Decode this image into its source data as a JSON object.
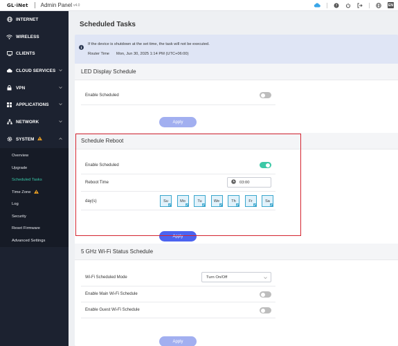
{
  "topbar": {
    "logo": "GL·iNet",
    "title": "Admin Panel",
    "version": "v4.0",
    "icons": [
      "cloud-icon",
      "help-icon",
      "power-icon",
      "logout-icon",
      "globe-icon",
      "language-icon"
    ],
    "language": "EN"
  },
  "sidebar": {
    "items": [
      {
        "label": "INTERNET",
        "icon": "globe-icon"
      },
      {
        "label": "WIRELESS",
        "icon": "wifi-icon"
      },
      {
        "label": "CLIENTS",
        "icon": "clients-icon"
      },
      {
        "label": "CLOUD SERVICES",
        "icon": "cloud-icon"
      },
      {
        "label": "VPN",
        "icon": "vpn-icon"
      },
      {
        "label": "APPLICATIONS",
        "icon": "applications-icon"
      },
      {
        "label": "NETWORK",
        "icon": "network-icon"
      },
      {
        "label": "SYSTEM",
        "icon": "gear-icon"
      }
    ],
    "system_sub": [
      {
        "label": "Overview"
      },
      {
        "label": "Upgrade"
      },
      {
        "label": "Scheduled Tasks",
        "active": true
      },
      {
        "label": "Time Zone",
        "warning": true
      },
      {
        "label": "Log"
      },
      {
        "label": "Security"
      },
      {
        "label": "Reset Firmware"
      },
      {
        "label": "Advanced Settings"
      }
    ]
  },
  "page": {
    "title": "Scheduled Tasks",
    "notice": {
      "line1": "If the device is shutdown at the set time, the task will not be executed.",
      "time_label": "Router Time",
      "time_value": "Mon, Jun 30, 2025 1:14 PM (UTC+06:00)"
    }
  },
  "led": {
    "title": "LED Display Schedule",
    "enable_label": "Enable Scheduled",
    "enabled": false,
    "apply": "Apply"
  },
  "reboot": {
    "title": "Schedule Reboot",
    "enable_label": "Enable Scheduled",
    "enabled": true,
    "time_label": "Reboot Time",
    "time_value": "03:00",
    "days_label": "day(s)",
    "days": [
      "Su",
      "Mo",
      "Tu",
      "We",
      "Th",
      "Fr",
      "Sa"
    ],
    "apply": "Apply"
  },
  "wifi": {
    "title": "5 GHz Wi-Fi Status Schedule",
    "mode_label": "Wi-Fi Scheduled Mode",
    "mode_value": "Turn On/Off",
    "main_label": "Enable Main Wi-Fi Schedule",
    "guest_label": "Enable Guest Wi-Fi Schedule",
    "apply": "Apply"
  },
  "colors": {
    "sidebar_bg": "#1c2230",
    "accent_green": "#3cc8a6",
    "primary_blue": "#4b63f0",
    "highlight_red": "#d4232e"
  }
}
